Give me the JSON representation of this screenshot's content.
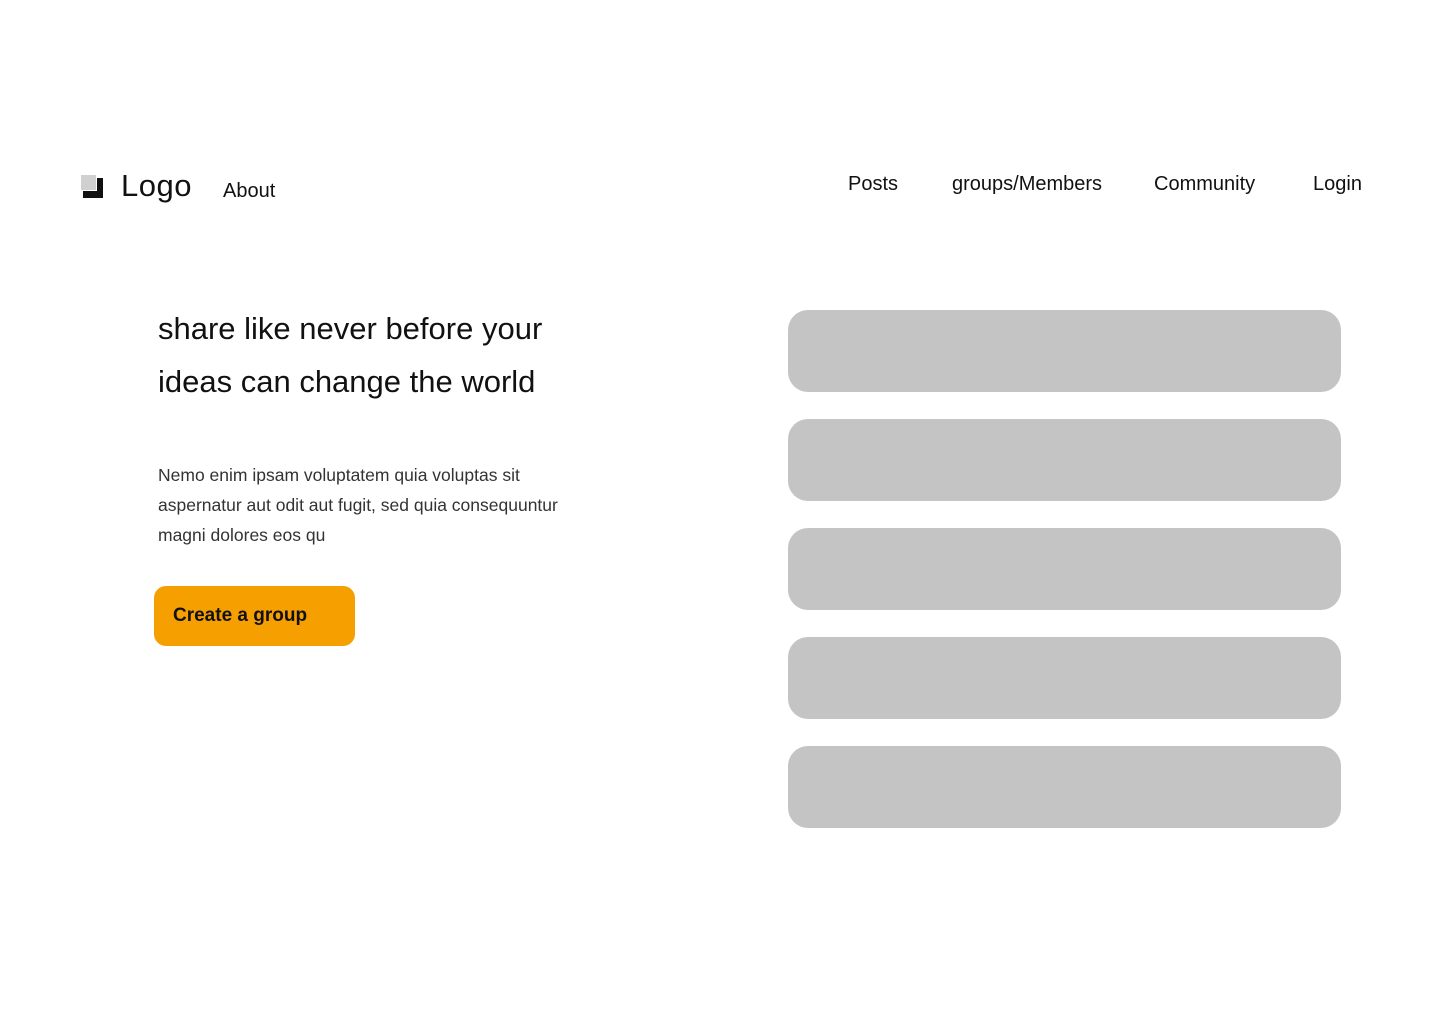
{
  "header": {
    "logo_label": "Logo",
    "about_label": "About",
    "nav": [
      {
        "label": "Posts"
      },
      {
        "label": "groups/Members"
      },
      {
        "label": "Community"
      },
      {
        "label": "Login"
      }
    ]
  },
  "hero": {
    "title": "share like never before your ideas can change the world",
    "body": "Nemo enim ipsam voluptatem quia voluptas sit aspernatur aut odit aut fugit, sed quia consequuntur magni dolores eos qu",
    "cta_label": "Create a group"
  },
  "cards": {
    "count": 5,
    "color": "#c4c4c4"
  },
  "colors": {
    "accent": "#f59f00",
    "background": "#ffffff",
    "text": "#111111"
  }
}
